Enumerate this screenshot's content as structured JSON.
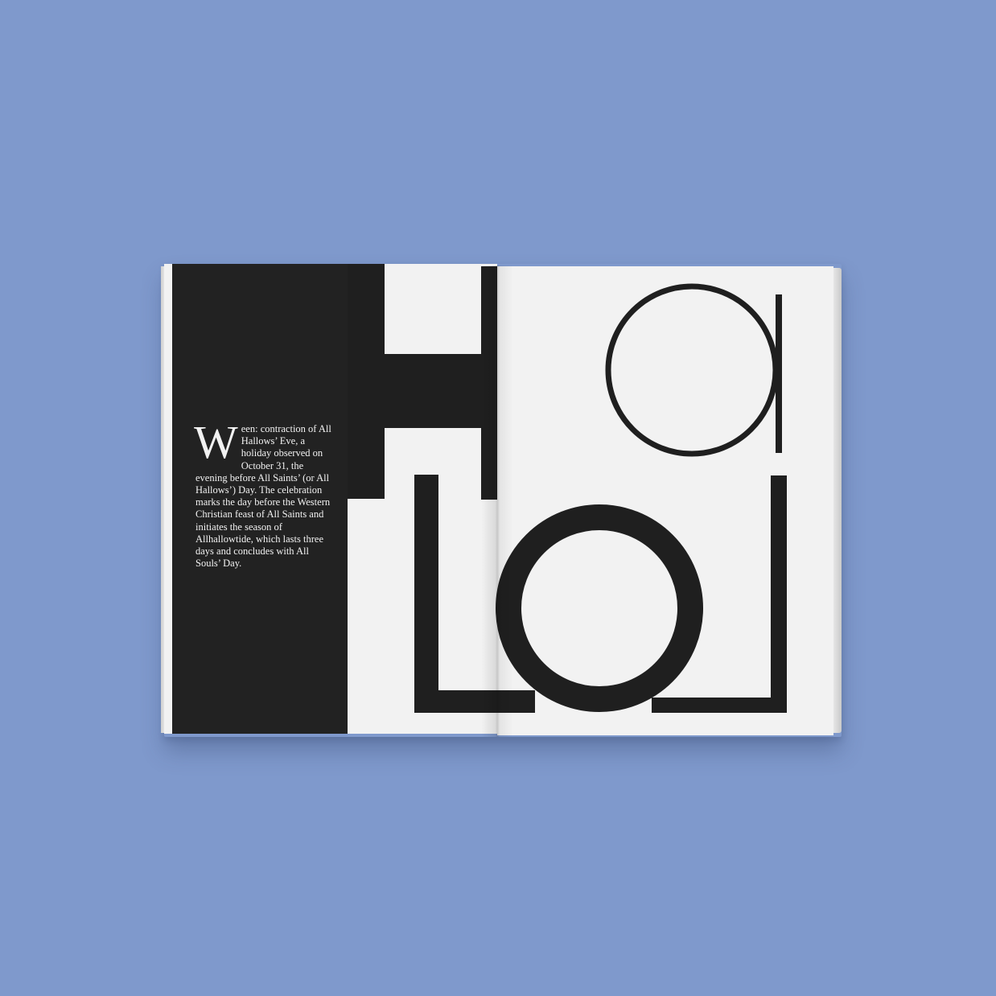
{
  "background_color": "#7f99cc",
  "spread": {
    "left_page": {
      "panel_color": "#222222",
      "drop_cap": "W",
      "body_text": "een: contraction of All Hallows’ Eve, a holiday observed on October 31, the evening before All Saints’ (or All Hallows’) Day. The celebration marks the day before the Western Christian feast of All Saints and initiates the season of Allhallowtide, which lasts three days and concludes with All Souls’ Day."
    },
    "display_letters": [
      "H",
      "a",
      "L",
      "o",
      "L"
    ],
    "letter_color": "#1f1f1f",
    "paper_color": "#f2f2f2"
  }
}
